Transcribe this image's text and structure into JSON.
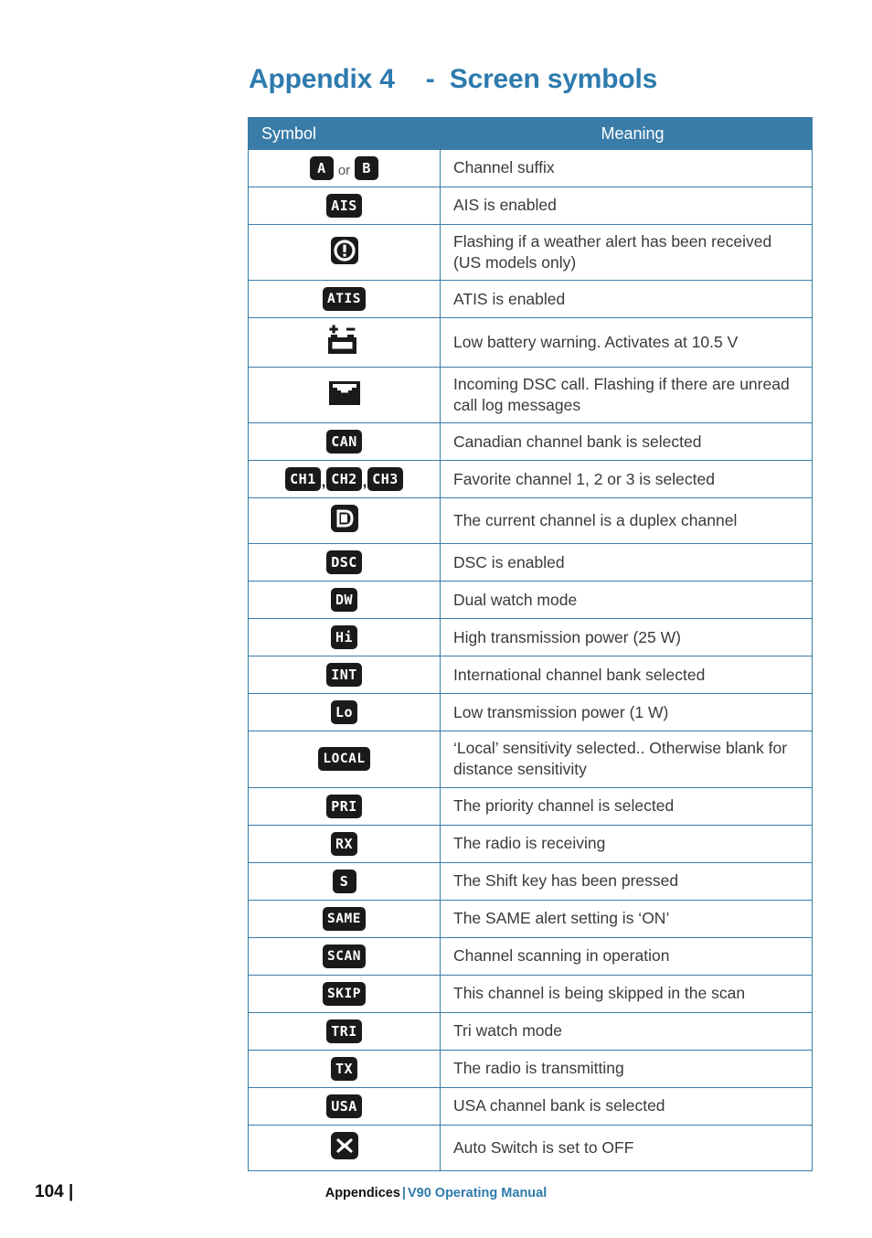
{
  "page": {
    "title_main": "Appendix 4",
    "title_dash": "-",
    "title_sub": "Screen symbols"
  },
  "table": {
    "headers": {
      "symbol": "Symbol",
      "meaning": "Meaning"
    },
    "rows": [
      {
        "symbol_text": "A or B",
        "symbols": [
          "A",
          "B"
        ],
        "connector": "or",
        "icon": "badge",
        "meaning": "Channel suffix"
      },
      {
        "symbol_text": "AIS",
        "symbols": [
          "AIS"
        ],
        "icon": "badge",
        "meaning": "AIS is enabled"
      },
      {
        "symbol_text": "!",
        "symbols": [
          "!"
        ],
        "icon": "alert-circle",
        "meaning": "Flashing if a weather alert has been received (US models only)"
      },
      {
        "symbol_text": "ATIS",
        "symbols": [
          "ATIS"
        ],
        "icon": "badge",
        "meaning": "ATIS is enabled"
      },
      {
        "symbol_text": "battery",
        "symbols": [],
        "icon": "battery",
        "meaning": "Low battery warning. Activates at 10.5 V"
      },
      {
        "symbol_text": "envelope",
        "symbols": [],
        "icon": "envelope",
        "meaning": "Incoming DSC call. Flashing if there are unread call log messages"
      },
      {
        "symbol_text": "CAN",
        "symbols": [
          "CAN"
        ],
        "icon": "badge",
        "meaning": "Canadian channel bank is selected"
      },
      {
        "symbol_text": "CH1, CH2, CH3",
        "symbols": [
          "CH1",
          "CH2",
          "CH3"
        ],
        "connector": ",",
        "icon": "badge",
        "meaning": "Favorite channel 1, 2 or 3 is selected"
      },
      {
        "symbol_text": "D",
        "symbols": [
          "D"
        ],
        "icon": "duplex",
        "meaning": "The current channel is a duplex channel"
      },
      {
        "symbol_text": "DSC",
        "symbols": [
          "DSC"
        ],
        "icon": "badge",
        "meaning": "DSC is enabled"
      },
      {
        "symbol_text": "DW",
        "symbols": [
          "DW"
        ],
        "icon": "badge",
        "meaning": "Dual watch mode"
      },
      {
        "symbol_text": "Hi",
        "symbols": [
          "Hi"
        ],
        "icon": "badge",
        "meaning": "High transmission power (25 W)"
      },
      {
        "symbol_text": "INT",
        "symbols": [
          "INT"
        ],
        "icon": "badge",
        "meaning": "International channel bank selected"
      },
      {
        "symbol_text": "Lo",
        "symbols": [
          "Lo"
        ],
        "icon": "badge",
        "meaning": "Low transmission power (1 W)"
      },
      {
        "symbol_text": "LOCAL",
        "symbols": [
          "LOCAL"
        ],
        "icon": "badge",
        "meaning": "‘Local’ sensitivity selected.. Otherwise blank for distance sensitivity"
      },
      {
        "symbol_text": "PRI",
        "symbols": [
          "PRI"
        ],
        "icon": "badge",
        "meaning": "The priority channel is selected"
      },
      {
        "symbol_text": "RX",
        "symbols": [
          "RX"
        ],
        "icon": "badge",
        "meaning": "The radio is receiving"
      },
      {
        "symbol_text": "S",
        "symbols": [
          "S"
        ],
        "icon": "badge",
        "meaning": "The Shift key has been pressed"
      },
      {
        "symbol_text": "SAME",
        "symbols": [
          "SAME"
        ],
        "icon": "badge",
        "meaning": "The SAME alert setting is ‘ON’"
      },
      {
        "symbol_text": "SCAN",
        "symbols": [
          "SCAN"
        ],
        "icon": "badge",
        "meaning": "Channel scanning in operation"
      },
      {
        "symbol_text": "SKIP",
        "symbols": [
          "SKIP"
        ],
        "icon": "badge",
        "meaning": "This channel is being skipped in the scan"
      },
      {
        "symbol_text": "TRI",
        "symbols": [
          "TRI"
        ],
        "icon": "badge",
        "meaning": "Tri watch mode"
      },
      {
        "symbol_text": "TX",
        "symbols": [
          "TX"
        ],
        "icon": "badge",
        "meaning": "The radio is transmitting"
      },
      {
        "symbol_text": "USA",
        "symbols": [
          "USA"
        ],
        "icon": "badge",
        "meaning": "USA channel bank is selected"
      },
      {
        "symbol_text": "X",
        "symbols": [
          "X"
        ],
        "icon": "cross",
        "meaning": "Auto Switch is set to OFF"
      }
    ]
  },
  "footer": {
    "page_number": "104",
    "page_bar": "|",
    "section": "Appendices",
    "separator": "|",
    "manual": "V90 Operating Manual"
  },
  "colors": {
    "accent_blue": "#3A7CA8",
    "title_blue": "#2E7BAE",
    "text_gray": "#3A3A3A",
    "lcd_black": "#1A1A1A"
  }
}
